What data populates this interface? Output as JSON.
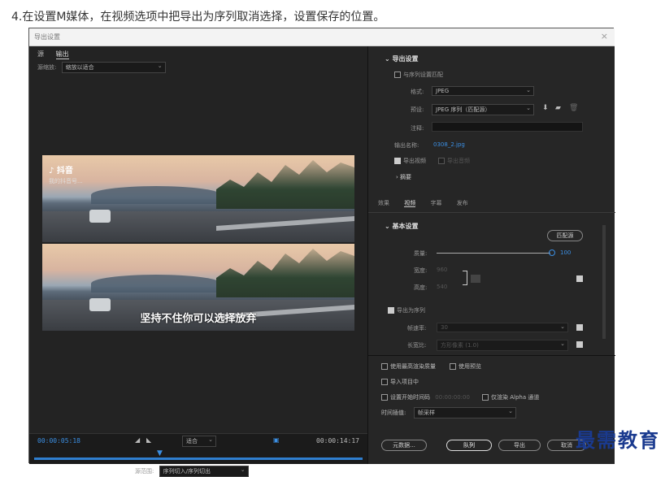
{
  "caption": "4.在设置M媒体，在视频选项中把导出为序列取消选择，设置保存的位置。",
  "dialog": {
    "title": "导出设置",
    "close": "×"
  },
  "left_panel": {
    "tabs": [
      {
        "label": "源",
        "active": false
      },
      {
        "label": "输出",
        "active": true
      }
    ],
    "source_scaling_label": "源缩放:",
    "source_scaling_value": "缩放以适合",
    "preview": {
      "logo_text": "抖音",
      "logo_sub": "我的抖音号...",
      "subtitle": "坚持不住你可以选择放弃"
    },
    "timeline": {
      "current_time": "00:00:05:18",
      "end_time": "00:00:14:17",
      "fit_label": "适合",
      "range_label": "源范围:",
      "range_value": "序列切入/序列切出"
    }
  },
  "export_settings": {
    "section_title": "导出设置",
    "match_sequence_label": "与序列设置匹配",
    "format_label": "格式:",
    "format_value": "JPEG",
    "preset_label": "预设:",
    "preset_value": "JPEG 序列（匹配源）",
    "comment_label": "注释:",
    "output_name_label": "输出名称:",
    "output_name_value": "0308_2.jpg",
    "export_video_label": "导出视频",
    "export_audio_label": "导出音频",
    "summary_label": "摘要"
  },
  "settings_tabs": [
    {
      "label": "效果",
      "active": false
    },
    {
      "label": "视频",
      "active": true
    },
    {
      "label": "字幕",
      "active": false
    },
    {
      "label": "发布",
      "active": false
    }
  ],
  "basic_settings": {
    "section_title": "基本设置",
    "match_source_button": "匹配源",
    "quality_label": "质量:",
    "quality_value": "100",
    "width_label": "宽度:",
    "width_value": "960",
    "height_label": "高度:",
    "height_value": "540",
    "export_as_sequence_label": "导出为序列",
    "frame_rate_label": "帧速率:",
    "frame_rate_value": "30",
    "aspect_label": "长宽比:",
    "aspect_value": "方形像素 (1.0)"
  },
  "bottom_options": {
    "max_render_label": "使用最高渲染质量",
    "use_preview_label": "使用预览",
    "import_project_label": "导入项目中",
    "set_start_timecode_label": "设置开始时间码",
    "start_timecode_value": "00:00:00:00",
    "render_alpha_label": "仅渲染 Alpha 通道",
    "interpolation_label": "时间插值:",
    "interpolation_value": "帧采样"
  },
  "buttons": {
    "metadata": "元数据...",
    "queue": "队列",
    "export": "导出",
    "cancel": "取消"
  },
  "watermark": "最需教育"
}
